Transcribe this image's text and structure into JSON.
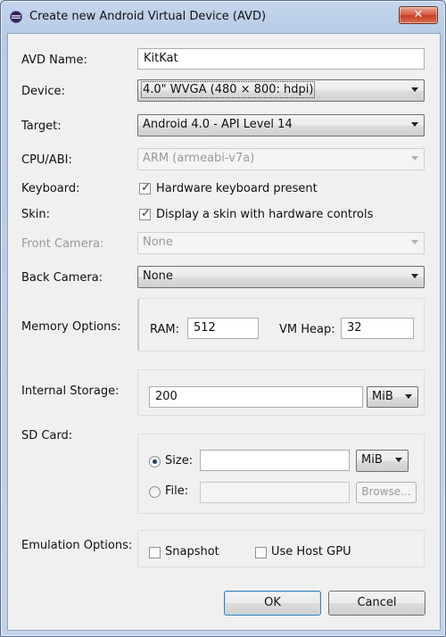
{
  "window": {
    "title": "Create new Android Virtual Device (AVD)",
    "close_glyph": "✕"
  },
  "form": {
    "avd_name": {
      "label": "AVD Name:",
      "value": "KitKat"
    },
    "device": {
      "label": "Device:",
      "value": "4.0\" WVGA (480 × 800: hdpi)"
    },
    "target": {
      "label": "Target:",
      "value": "Android 4.0 - API Level 14"
    },
    "cpu_abi": {
      "label": "CPU/ABI:",
      "value": "ARM (armeabi-v7a)"
    },
    "keyboard": {
      "label": "Keyboard:",
      "checkbox_label": "Hardware keyboard present",
      "checked": true
    },
    "skin": {
      "label": "Skin:",
      "checkbox_label": "Display a skin with hardware controls",
      "checked": true
    },
    "front_camera": {
      "label": "Front Camera:",
      "value": "None"
    },
    "back_camera": {
      "label": "Back Camera:",
      "value": "None"
    },
    "memory": {
      "label": "Memory Options:",
      "ram_label": "RAM:",
      "ram_value": "512",
      "heap_label": "VM Heap:",
      "heap_value": "32"
    },
    "internal_storage": {
      "label": "Internal Storage:",
      "value": "200",
      "unit": "MiB"
    },
    "sd_card": {
      "label": "SD Card:",
      "size_label": "Size:",
      "size_value": "",
      "size_unit": "MiB",
      "file_label": "File:",
      "file_value": "",
      "browse_label": "Browse...",
      "selected": "size"
    },
    "emulation": {
      "label": "Emulation Options:",
      "snapshot_label": "Snapshot",
      "snapshot_checked": false,
      "gpu_label": "Use Host GPU",
      "gpu_checked": false
    }
  },
  "buttons": {
    "ok": "OK",
    "cancel": "Cancel"
  }
}
